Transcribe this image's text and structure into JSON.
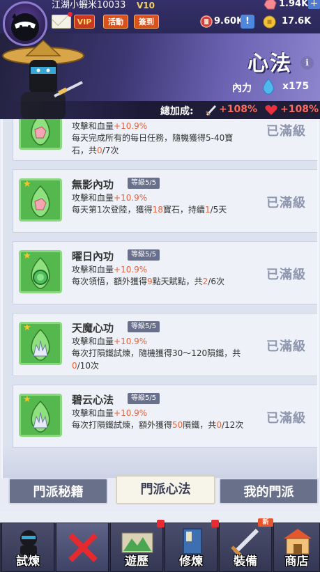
{
  "top": {
    "player_name": "江湖小蝦米10033",
    "vip_level": "V10",
    "vip_label": "VIP",
    "event_label": "活動",
    "signin_label": "簽到",
    "gems": "1.94K",
    "tokens": "9.60K",
    "coins": "17.6K",
    "add_symbol": "+",
    "warn_symbol": "!"
  },
  "banner": {
    "title": "心法",
    "info_symbol": "i",
    "inner_label": "內力",
    "inner_value": "x175",
    "bonus_label": "總加成:",
    "bonus_attack": "+108%",
    "bonus_hp": "+108%"
  },
  "cards": [
    {
      "name": "",
      "level": "",
      "stat_prefix": "攻擊和血量",
      "stat_value": "+10.9%",
      "desc_parts": [
        "每天完成所有的每日任務，隨機獲得5-40寶石，共",
        "0",
        "/7次"
      ],
      "status": "已滿級",
      "icon": "gem-flask-icon"
    },
    {
      "name": "無影內功",
      "level": "等級5/5",
      "stat_prefix": "攻擊和血量",
      "stat_value": "+10.9%",
      "desc_parts": [
        "每天第1次登陸，獲得",
        "18",
        "寶石，持續",
        "1",
        "/5天"
      ],
      "status": "已滿級",
      "icon": "gem-flask-icon"
    },
    {
      "name": "曜日內功",
      "level": "等級5/5",
      "stat_prefix": "攻擊和血量",
      "stat_value": "+10.9%",
      "desc_parts": [
        "每次領悟，額外獲得",
        "9",
        "點天賦點，共",
        "2",
        "/6次"
      ],
      "status": "已滿級",
      "icon": "orb-flask-icon"
    },
    {
      "name": "天魔心功",
      "level": "等級5/5",
      "stat_prefix": "攻擊和血量",
      "stat_value": "+10.9%",
      "desc_parts": [
        "每次打隕鐵試煉，隨機獲得30～120隕鐵，共",
        "0",
        "/10次"
      ],
      "status": "已滿級",
      "icon": "crystal-flask-icon"
    },
    {
      "name": "碧云心法",
      "level": "等級5/5",
      "stat_prefix": "攻擊和血量",
      "stat_value": "+10.9%",
      "desc_parts": [
        "每次打隕鐵試煉，額外獲得",
        "50",
        "隕鐵，共",
        "0",
        "/12次"
      ],
      "status": "已滿級",
      "icon": "crystal-flask-icon"
    }
  ],
  "tabs": [
    "門派秘籍",
    "門派心法",
    "我的門派"
  ],
  "nav": [
    "試煉",
    "",
    "遊歷",
    "修煉",
    "裝備",
    "商店"
  ],
  "nav_new_badge": "新",
  "colors": {
    "accent_red": "#ff6b5b",
    "highlight_orange": "#e8623a",
    "panel_bg": "#dde2ef"
  }
}
